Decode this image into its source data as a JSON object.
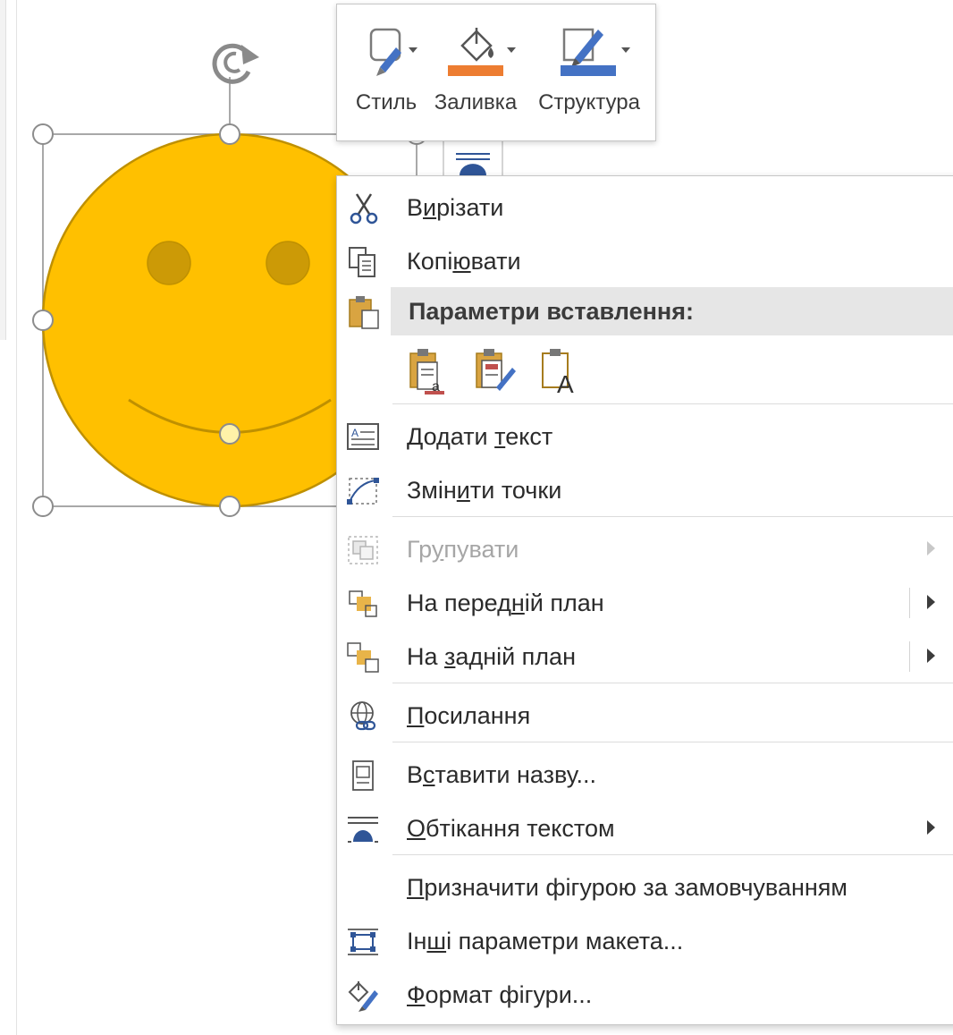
{
  "mini_toolbar": {
    "buttons": [
      {
        "label": "Стиль",
        "icon": "shape-style-icon"
      },
      {
        "label": "Заливка",
        "icon": "paint-bucket-icon"
      },
      {
        "label": "Структура",
        "icon": "pen-outline-icon"
      }
    ]
  },
  "context_menu": {
    "cut": {
      "label_a": "В",
      "label_u": "и",
      "label_b": "різати"
    },
    "copy": {
      "label_a": "Копі",
      "label_u": "ю",
      "label_b": "вати"
    },
    "paste_options_header": "Параметри вставлення:",
    "paste_options": [
      "keep-source-formatting-icon",
      "merge-formatting-icon",
      "keep-text-only-icon"
    ],
    "add_text": {
      "label_a": "Додати ",
      "label_u": "т",
      "label_b": "екст"
    },
    "edit_points": {
      "label_a": "Змін",
      "label_u": "и",
      "label_b": "ти точки"
    },
    "group": {
      "label_a": "Гр",
      "label_u": "у",
      "label_b": "пувати"
    },
    "bring_forward": {
      "label_a": "На перед",
      "label_u": "н",
      "label_b": "ій план"
    },
    "send_backward": {
      "label_a": "На ",
      "label_u": "з",
      "label_b": "адній план"
    },
    "link": {
      "label_a": "",
      "label_u": "П",
      "label_b": "осилання"
    },
    "insert_caption": {
      "label_a": "В",
      "label_u": "с",
      "label_b": "тавити назву..."
    },
    "wrap_text": {
      "label_a": "",
      "label_u": "О",
      "label_b": "бтікання текстом"
    },
    "set_default": {
      "label_a": "",
      "label_u": "П",
      "label_b": "ризначити фігурою за замовчуванням"
    },
    "more_layout": {
      "label_a": "Ін",
      "label_u": "ш",
      "label_b": "і параметри макета..."
    },
    "format_shape": {
      "label_a": "",
      "label_u": "Ф",
      "label_b": "ормат фігури..."
    }
  },
  "colors": {
    "smiley_fill": "#ffc000",
    "smiley_stroke": "#bf9000",
    "fill_accent": "#ed7d31",
    "outline_accent": "#4472c4"
  }
}
